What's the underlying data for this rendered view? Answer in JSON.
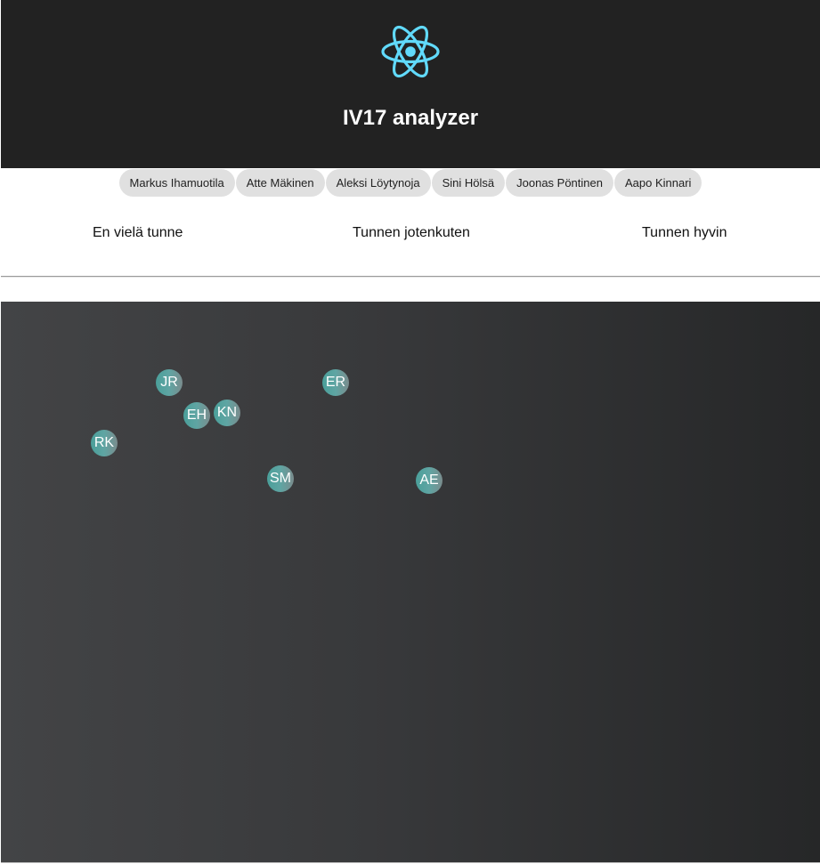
{
  "header": {
    "title": "IV17 analyzer",
    "logo_icon": "react-atom-icon",
    "logo_color": "#61dafb",
    "background": "#222222"
  },
  "person_tabs": [
    {
      "label": "Markus Ihamuotila"
    },
    {
      "label": "Atte Mäkinen"
    },
    {
      "label": "Aleksi Löytynoja"
    },
    {
      "label": "Sini Hölsä"
    },
    {
      "label": "Joonas Pöntinen"
    },
    {
      "label": "Aapo Kinnari"
    }
  ],
  "scale": {
    "left": "En vielä tunne",
    "middle": "Tunnen jotenkuten",
    "right": "Tunnen hyvin"
  },
  "board": {
    "chips": [
      {
        "initials": "JR"
      },
      {
        "initials": "ER"
      },
      {
        "initials": "EH"
      },
      {
        "initials": "KN"
      },
      {
        "initials": "RK"
      },
      {
        "initials": "SM"
      },
      {
        "initials": "AE"
      }
    ]
  }
}
